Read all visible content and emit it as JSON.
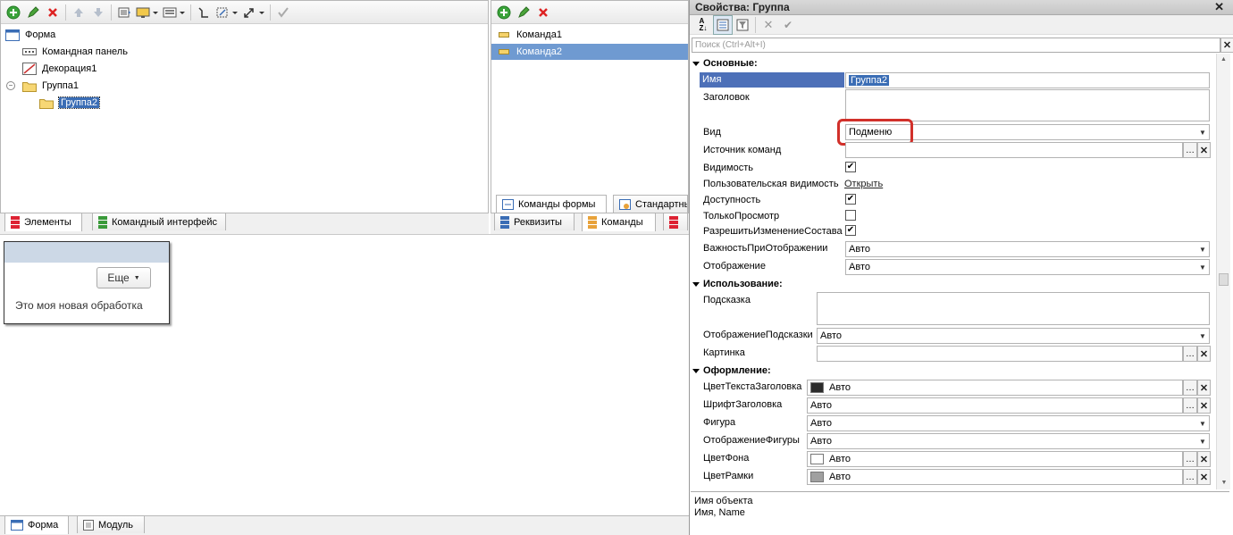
{
  "elements_tree": {
    "items": [
      {
        "label": "Форма",
        "icon": "form-icon"
      },
      {
        "label": "Командная панель",
        "icon": "command-bar-icon"
      },
      {
        "label": "Декорация1",
        "icon": "decoration-icon"
      },
      {
        "label": "Группа1",
        "icon": "folder-icon"
      },
      {
        "label": "Группа2",
        "icon": "folder-icon"
      }
    ],
    "tabs": [
      "Элементы",
      "Командный интерфейс"
    ]
  },
  "commands_panel": {
    "items": [
      "Команда1",
      "Команда2"
    ],
    "inner_tabs": [
      "Команды формы",
      "Стандартны"
    ],
    "tabs": [
      "Реквизиты",
      "Команды"
    ]
  },
  "preview": {
    "more_button": "Еще",
    "text": "Это моя новая обработка"
  },
  "bottom_tabs": [
    "Форма",
    "Модуль"
  ],
  "properties": {
    "title": "Свойства: Группа",
    "search_placeholder": "Поиск (Ctrl+Alt+I)",
    "sections": {
      "main": "Основные:",
      "usage": "Использование:",
      "design": "Оформление:"
    },
    "rows": {
      "name": {
        "label": "Имя",
        "value": "Группа2"
      },
      "caption": {
        "label": "Заголовок",
        "value": ""
      },
      "view": {
        "label": "Вид",
        "value": "Подменю"
      },
      "cmd_source": {
        "label": "Источник команд",
        "value": ""
      },
      "visibility": {
        "label": "Видимость"
      },
      "user_visibility": {
        "label": "Пользовательская видимость",
        "value": "Открыть"
      },
      "enabled": {
        "label": "Доступность"
      },
      "readonly": {
        "label": "ТолькоПросмотр"
      },
      "allow_change": {
        "label": "РазрешитьИзменениеСостава"
      },
      "importance": {
        "label": "ВажностьПриОтображении",
        "value": "Авто"
      },
      "display": {
        "label": "Отображение",
        "value": "Авто"
      },
      "tooltip": {
        "label": "Подсказка",
        "value": ""
      },
      "tooltip_display": {
        "label": "ОтображениеПодсказки",
        "value": "Авто"
      },
      "picture": {
        "label": "Картинка",
        "value": ""
      },
      "title_color": {
        "label": "ЦветТекстаЗаголовка",
        "value": "Авто",
        "swatch": "#2b2b2b"
      },
      "title_font": {
        "label": "ШрифтЗаголовка",
        "value": "Авто"
      },
      "shape": {
        "label": "Фигура",
        "value": "Авто"
      },
      "shape_display": {
        "label": "ОтображениеФигуры",
        "value": "Авто"
      },
      "back_color": {
        "label": "ЦветФона",
        "value": "Авто",
        "swatch": "#ffffff"
      },
      "border_color": {
        "label": "ЦветРамки",
        "value": "Авто",
        "swatch": "#a0a0a0"
      }
    },
    "description_lines": [
      "Имя объекта",
      "Имя, Name"
    ]
  },
  "colors": {
    "selection": "#3a6db5",
    "name_label_bg": "#4d70b8",
    "highlight_border": "#d1302a"
  }
}
